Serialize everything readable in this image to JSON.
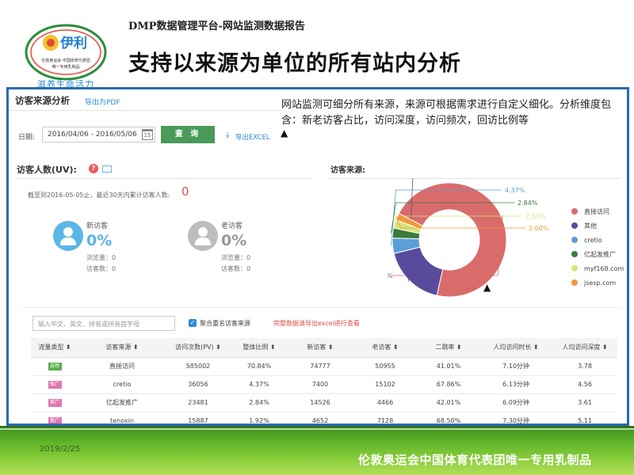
{
  "slide": {
    "subtitle": "DMP数据管理平台-网站监测数据报告",
    "title": "支持以来源为单位的所有站内分析",
    "logo_brand": "伊利",
    "logo_caption_1": "伦敦奥运会 中国体育代表团",
    "logo_caption_2": "唯一专用乳制品",
    "logo_slogan": "滋养生命活力",
    "description": "网站监测可细分所有来源，来源可根据需求进行自定义细化。分析维度包含：新老访客占比，访问深度，访问频次，回访比例等",
    "footer_date": "2019/2/25",
    "footer_text": "伦敦奥运会中国体育代表团唯一专用乳制品"
  },
  "app": {
    "section_title": "访客来源分析",
    "export_pdf": "导出为PDF",
    "date_label": "日期:",
    "date_value": "2016/04/06 - 2016/05/06",
    "calendar_text": "15",
    "query_button": "查 询",
    "export_excel": "导出EXCEL",
    "uv_title": "访客人数(UV):",
    "help_icon": "?",
    "cumulative_text": "截至到2016-05-05止，最近30天内累计访客人数:",
    "cumulative_value": "0",
    "new_visitor": {
      "label": "新访客",
      "percent": "0%",
      "pv_label": "浏览量：",
      "pv_value": "0",
      "uv_label": "访客数：",
      "uv_value": "0"
    },
    "old_visitor": {
      "label": "老访客",
      "percent": "0%",
      "pv_label": "浏览量：",
      "pv_value": "0",
      "uv_label": "访客数：",
      "uv_value": "0"
    },
    "source_title": "访客来源:",
    "search_placeholder": "输入中文、英文、拼音或拼音首字母",
    "merge_label": "聚合重名访客来源",
    "export_hint": "完整数据请导出excel进行查看",
    "checkbox_mark": "✓"
  },
  "chart_data": {
    "type": "pie",
    "donut": true,
    "slices": [
      {
        "name": "直接访问",
        "value": 70.84,
        "label": "70.84%",
        "color": "#d96b6b"
      },
      {
        "name": "其他",
        "value": 17.63,
        "label": "17.63%",
        "color": "#5a4a9c"
      },
      {
        "name": "cretio",
        "value": 4.37,
        "label": "4.37%",
        "color": "#5a9fd6"
      },
      {
        "name": "亿起发推广",
        "value": 2.84,
        "label": "2.84%",
        "color": "#3c7a3c"
      },
      {
        "name": "myf168.com",
        "value": 2.33,
        "label": "2.33%",
        "color": "#d8e27a"
      },
      {
        "name": "jsesp.com",
        "value": 2.0,
        "label": "2.00%",
        "color": "#f09a3a"
      }
    ],
    "legend_position": "right"
  },
  "table": {
    "headers": [
      "流量类型 ⬍",
      "访客来源 ⬍",
      "访问次数(PV) ⬍",
      "整体比例 ⬍",
      "新访客 ⬍",
      "老访客 ⬍",
      "二跳率 ⬍",
      "人均访问时长 ⬍",
      "人均访问深度 ⬍"
    ],
    "rows": [
      {
        "type": "自然",
        "type_color": "#5aae4c",
        "source": "直接访问",
        "pv": "585002",
        "ratio": "70.84%",
        "new": "74777",
        "old": "50955",
        "bounce": "41.01%",
        "duration": "7.10分钟",
        "depth": "3.78"
      },
      {
        "type": "推广",
        "type_color": "#e078b2",
        "source": "cretio",
        "pv": "36056",
        "ratio": "4.37%",
        "new": "7400",
        "old": "15102",
        "bounce": "67.86%",
        "duration": "6.13分钟",
        "depth": "4.56"
      },
      {
        "type": "推广",
        "type_color": "#e078b2",
        "source": "亿起发推广",
        "pv": "23481",
        "ratio": "2.84%",
        "new": "14526",
        "old": "4466",
        "bounce": "42.01%",
        "duration": "6.09分钟",
        "depth": "3.61"
      },
      {
        "type": "推广",
        "type_color": "#e078b2",
        "source": "tenoxin",
        "pv": "15887",
        "ratio": "1.92%",
        "new": "4652",
        "old": "7128",
        "bounce": "68.50%",
        "duration": "7.30分钟",
        "depth": "5.11"
      }
    ]
  }
}
